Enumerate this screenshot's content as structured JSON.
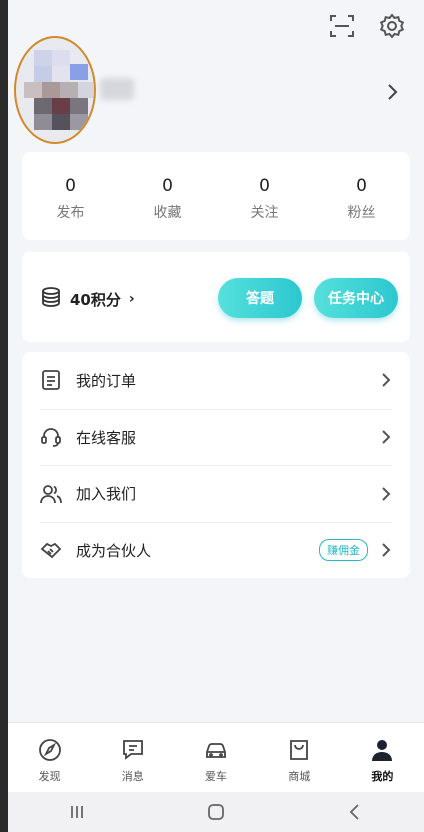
{
  "top_bar": {
    "scan_icon": "scan-icon",
    "settings_icon": "gear-icon"
  },
  "stats": [
    {
      "value": "0",
      "label": "发布"
    },
    {
      "value": "0",
      "label": "收藏"
    },
    {
      "value": "0",
      "label": "关注"
    },
    {
      "value": "0",
      "label": "粉丝"
    }
  ],
  "points": {
    "text": "40积分",
    "arrow": "›",
    "answer_button": "答题",
    "task_button": "任务中心"
  },
  "menu": [
    {
      "label": "我的订单",
      "icon": "list-icon"
    },
    {
      "label": "在线客服",
      "icon": "headset-icon"
    },
    {
      "label": "加入我们",
      "icon": "people-icon"
    },
    {
      "label": "成为合伙人",
      "icon": "handshake-icon",
      "badge": "赚佣金"
    }
  ],
  "tabs": [
    {
      "label": "发现",
      "icon": "compass-icon"
    },
    {
      "label": "消息",
      "icon": "chat-icon"
    },
    {
      "label": "爱车",
      "icon": "car-icon"
    },
    {
      "label": "商城",
      "icon": "shopping-bag-icon"
    },
    {
      "label": "我的",
      "icon": "user-icon",
      "active": true
    }
  ],
  "colors": {
    "accent": "#2cc7cf",
    "avatar_ring": "#d08a2a"
  }
}
